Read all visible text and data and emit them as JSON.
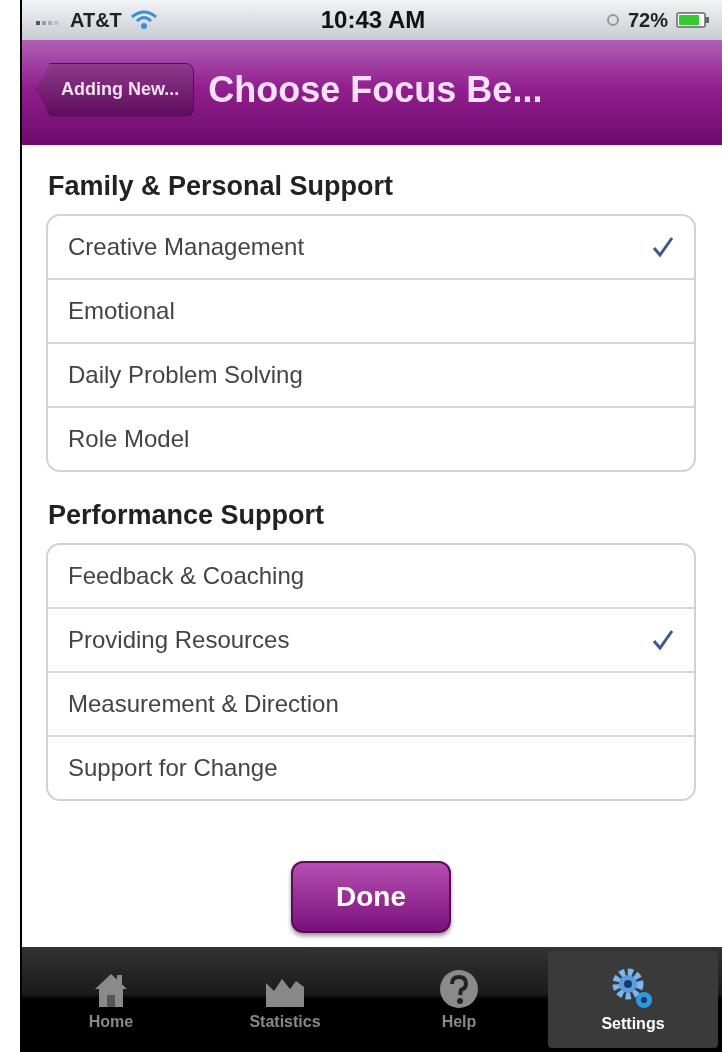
{
  "status_bar": {
    "carrier": "AT&T",
    "time": "10:43 AM",
    "battery": "72%"
  },
  "nav_bar": {
    "back_button": "Adding New...",
    "title": "Choose Focus Be..."
  },
  "sections": [
    {
      "header": "Family & Personal Support",
      "items": [
        {
          "label": "Creative Management",
          "checked": true
        },
        {
          "label": "Emotional",
          "checked": false
        },
        {
          "label": "Daily Problem Solving",
          "checked": false
        },
        {
          "label": "Role Model",
          "checked": false
        }
      ]
    },
    {
      "header": "Performance Support",
      "items": [
        {
          "label": "Feedback & Coaching",
          "checked": false
        },
        {
          "label": "Providing Resources",
          "checked": true
        },
        {
          "label": "Measurement & Direction",
          "checked": false
        },
        {
          "label": "Support for Change",
          "checked": false
        }
      ]
    }
  ],
  "done_button": "Done",
  "tab_bar": [
    {
      "kind": "home",
      "label": "Home",
      "selected": false
    },
    {
      "kind": "statistics",
      "label": "Statistics",
      "selected": false
    },
    {
      "kind": "help",
      "label": "Help",
      "selected": false
    },
    {
      "kind": "settings",
      "label": "Settings",
      "selected": true
    }
  ]
}
